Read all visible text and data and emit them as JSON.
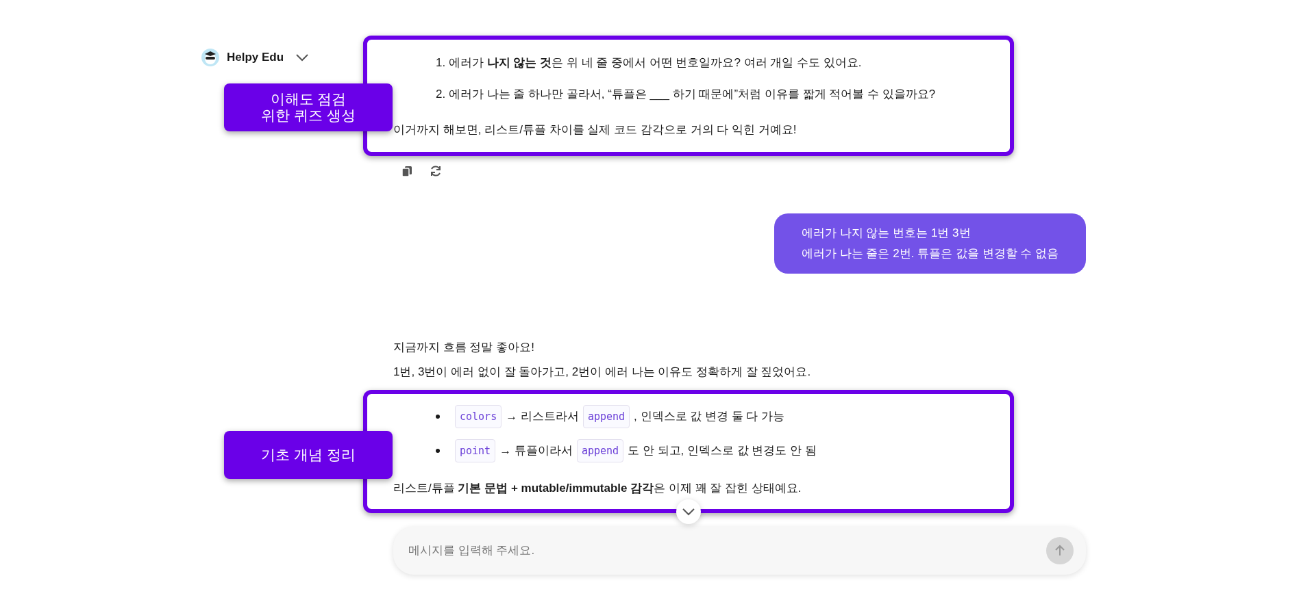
{
  "header": {
    "assistant_name": "Helpy Edu"
  },
  "quiz_block": {
    "annotation": [
      "이해도 점검",
      "위한 퀴즈 생성"
    ],
    "items": [
      "1. 에러가 **나지 않는 것**은 위 네 줄 중에서 어떤 번호일까요? 여러 개일 수도 있어요.",
      "2. 에러가 나는 줄 하나만 골라서, “튜플은 ___ 하기 때문에”처럼 이유를 짧게 적어볼 수 있을까요?"
    ],
    "closing": "이거까지 해보면, 리스트/튜플 차이를 실제 코드 감각으로 거의 다 익힌 거예요!"
  },
  "user_message": {
    "lines": [
      "에러가 나지 않는 번호는 1번 3번",
      "에러가 나는 줄은 2번. 튜플은 값을 변경할 수 없음"
    ]
  },
  "assistant_reply": {
    "lines": [
      "지금까지 흐름 정말 좋아요!",
      "1번, 3번이 에러 없이 잘 돌아가고, 2번이 에러 나는 이유도 정확하게 잘 짚었어요."
    ]
  },
  "summary_block": {
    "annotation": [
      "기초 개념 정리"
    ],
    "bullets": [
      [
        {
          "kind": "code",
          "text": "colors"
        },
        {
          "kind": "text",
          "text": "→ 리스트라서"
        },
        {
          "kind": "code",
          "text": "append"
        },
        {
          "kind": "text",
          "text": ", 인덱스로 값 변경 둘 다 가능"
        }
      ],
      [
        {
          "kind": "code",
          "text": "point"
        },
        {
          "kind": "text",
          "text": "→ 튜플이라서"
        },
        {
          "kind": "code",
          "text": "append"
        },
        {
          "kind": "text",
          "text": "도 안 되고, 인덱스로 값 변경도 안 됨"
        }
      ]
    ],
    "closing": "리스트/튜플 **기본 문법 + mutable/immutable 감각**은 이제 꽤 잘 잡힌 상태예요."
  },
  "composer": {
    "placeholder": "메시지를 입력해 주세요."
  }
}
